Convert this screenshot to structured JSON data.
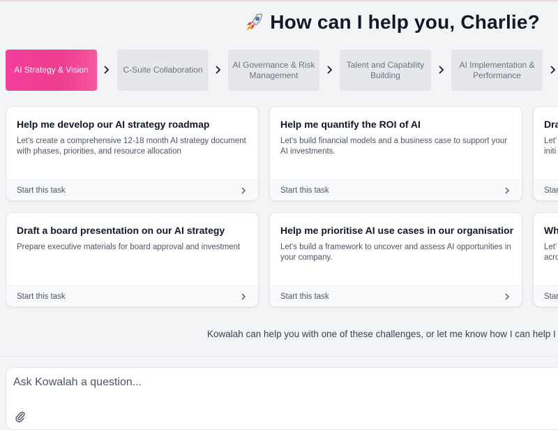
{
  "header": {
    "greeting": "How can I help you, Charlie?",
    "rocket_icon": "rocket-icon"
  },
  "steps": [
    {
      "label": "AI Strategy & Vision",
      "active": true
    },
    {
      "label": "C-Suite Collaboration",
      "active": false
    },
    {
      "label": "AI Governance & Risk Management",
      "active": false
    },
    {
      "label": "Talent and Capability Building",
      "active": false
    },
    {
      "label": "AI Implementation & Performance",
      "active": false
    }
  ],
  "cards": [
    {
      "title": "Help me develop our AI strategy roadmap",
      "desc": "Let's create a comprehensive 12-18 month AI strategy document with phases, priorities, and resource allocation",
      "cta": "Start this task"
    },
    {
      "title": "Help me quantify the ROI of AI",
      "desc": "Let's build financial models and a business case to support your AI investments.",
      "cta": "Start this task"
    },
    {
      "title": "Dra",
      "desc": "Let' initi",
      "cta": "Star"
    },
    {
      "title": "Draft a board presentation on our AI strategy",
      "desc": "Prepare executive materials for board approval and investment",
      "cta": "Start this task"
    },
    {
      "title": "Help me prioritise AI use cases in our organisation",
      "desc": "Let's build a framework to uncover and assess AI opportunities in your company.",
      "cta": "Start this task"
    },
    {
      "title": "Wh",
      "desc": "Let' acro",
      "cta": "Star"
    }
  ],
  "hint": "Kowalah can help you with one of these challenges, or let me know how I can help I",
  "composer": {
    "placeholder": "Ask Kowalah a question...",
    "attach_icon": "paperclip-icon"
  },
  "colors": {
    "accent": "#f43f9b",
    "background": "#f3f4f6",
    "step_inactive": "#e5e7eb"
  }
}
